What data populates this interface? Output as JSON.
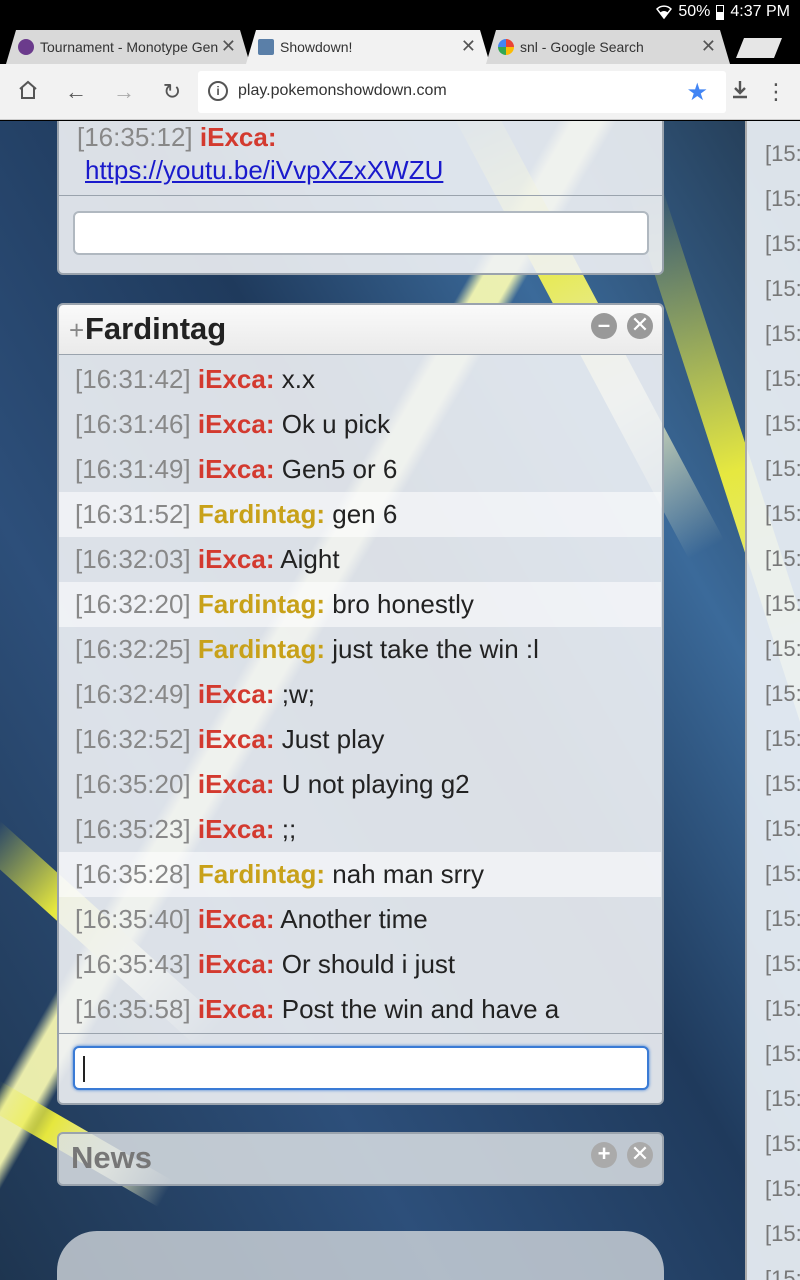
{
  "status_bar": {
    "battery": "50%",
    "time": "4:37 PM"
  },
  "tabs": [
    {
      "title": "Tournament - Monotype Gen",
      "favicon": "pokemon-showdown-forum-icon",
      "active": false
    },
    {
      "title": "Showdown!",
      "favicon": "showdown-icon",
      "active": true
    },
    {
      "title": "snl - Google Search",
      "favicon": "google-icon",
      "active": false
    }
  ],
  "toolbar": {
    "url": "play.pokemonshowdown.com"
  },
  "top_panel": {
    "last_message": {
      "timestamp": "[16:35:12]",
      "user": "iExca:",
      "text": "https://youtu.be/iVvpXZxXWZU"
    }
  },
  "fardintag_panel": {
    "plus": "+",
    "title": "Fardintag",
    "messages": [
      {
        "timestamp": "[16:31:42]",
        "user": "iExca:",
        "text": "x.x",
        "who": "iexca"
      },
      {
        "timestamp": "[16:31:46]",
        "user": "iExca:",
        "text": "Ok u pick",
        "who": "iexca"
      },
      {
        "timestamp": "[16:31:49]",
        "user": "iExca:",
        "text": "Gen5 or 6",
        "who": "iexca"
      },
      {
        "timestamp": "[16:31:52]",
        "user": "Fardintag:",
        "text": "gen 6",
        "who": "fard"
      },
      {
        "timestamp": "[16:32:03]",
        "user": "iExca:",
        "text": "Aight",
        "who": "iexca"
      },
      {
        "timestamp": "[16:32:20]",
        "user": "Fardintag:",
        "text": "bro honestly",
        "who": "fard"
      },
      {
        "timestamp": "[16:32:25]",
        "user": "Fardintag:",
        "text": "just take the win :l",
        "who": "fard"
      },
      {
        "timestamp": "[16:32:49]",
        "user": "iExca:",
        "text": ";w;",
        "who": "iexca"
      },
      {
        "timestamp": "[16:32:52]",
        "user": "iExca:",
        "text": "Just play",
        "who": "iexca"
      },
      {
        "timestamp": "[16:35:20]",
        "user": "iExca:",
        "text": "U not playing g2",
        "who": "iexca"
      },
      {
        "timestamp": "[16:35:23]",
        "user": "iExca:",
        "text": ";;",
        "who": "iexca"
      },
      {
        "timestamp": "[16:35:28]",
        "user": "Fardintag:",
        "text": "nah man srry",
        "who": "fard"
      },
      {
        "timestamp": "[16:35:40]",
        "user": "iExca:",
        "text": "Another time",
        "who": "iexca"
      },
      {
        "timestamp": "[16:35:43]",
        "user": "iExca:",
        "text": "Or should i just",
        "who": "iexca"
      },
      {
        "timestamp": "[16:35:58]",
        "user": "iExca:",
        "text": "Post the win and have a",
        "who": "iexca"
      }
    ]
  },
  "news_panel": {
    "title": "News"
  },
  "right_panel": {
    "line_text": "[15:"
  },
  "colors": {
    "iexca": "#d33a2f",
    "fardintag": "#c8a119",
    "accent": "#4285f4"
  }
}
